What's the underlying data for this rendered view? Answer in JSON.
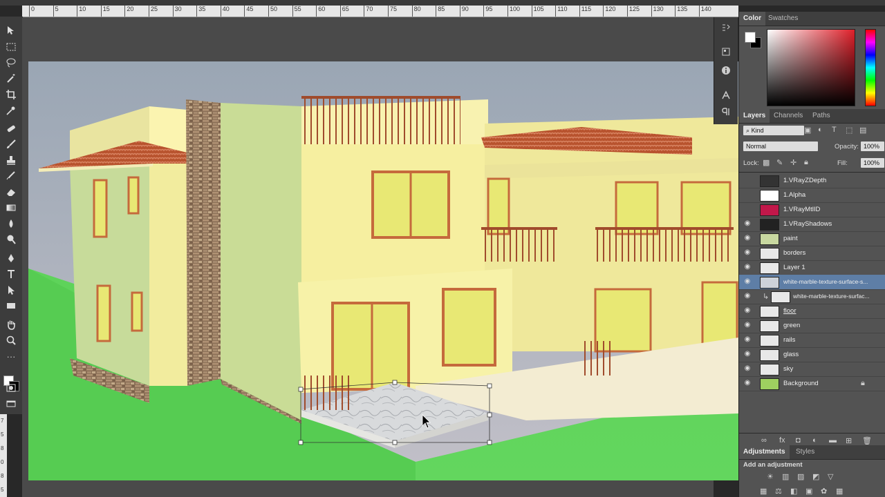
{
  "ruler": {
    "ticks": [
      "0",
      "5",
      "10",
      "15",
      "20",
      "25",
      "30",
      "35",
      "40",
      "45",
      "50",
      "55",
      "60",
      "65",
      "70",
      "75",
      "80",
      "85",
      "90",
      "95",
      "100",
      "105",
      "110",
      "115",
      "120",
      "125",
      "130",
      "135",
      "140"
    ],
    "vticks": [
      "7",
      "5",
      "8",
      "0",
      "8",
      "5"
    ]
  },
  "color_panel": {
    "tabs": [
      "Color",
      "Swatches"
    ]
  },
  "layers_panel": {
    "tabs": [
      "Layers",
      "Channels",
      "Paths"
    ],
    "filter_kind": "Kind",
    "blend_mode": "Normal",
    "opacity_label": "Opacity:",
    "opacity_value": "100%",
    "lock_label": "Lock:",
    "fill_label": "Fill:",
    "fill_value": "100%",
    "layers": [
      {
        "name": "1.VRayZDepth",
        "visible": false
      },
      {
        "name": "1.Alpha",
        "visible": false
      },
      {
        "name": "1.VRayMtlID",
        "visible": false
      },
      {
        "name": "1.VRayShadows",
        "visible": true
      },
      {
        "name": "paint",
        "visible": true
      },
      {
        "name": "borders",
        "visible": true
      },
      {
        "name": "Layer 1",
        "visible": true
      },
      {
        "name": "white-marble-texture-surface-s...",
        "visible": true,
        "selected": true
      },
      {
        "name": "white-marble-texture-surfac...",
        "visible": true,
        "clipped": true
      },
      {
        "name": "floor",
        "visible": true
      },
      {
        "name": "green",
        "visible": true
      },
      {
        "name": "rails",
        "visible": true
      },
      {
        "name": "glass",
        "visible": true
      },
      {
        "name": "sky",
        "visible": true
      },
      {
        "name": "Background",
        "visible": true,
        "locked": true
      }
    ]
  },
  "adjustments_panel": {
    "tabs": [
      "Adjustments",
      "Styles"
    ],
    "add_label": "Add an adjustment"
  },
  "colors": {
    "accent_selected": "#5e7ea6",
    "panel_bg": "#535353"
  }
}
